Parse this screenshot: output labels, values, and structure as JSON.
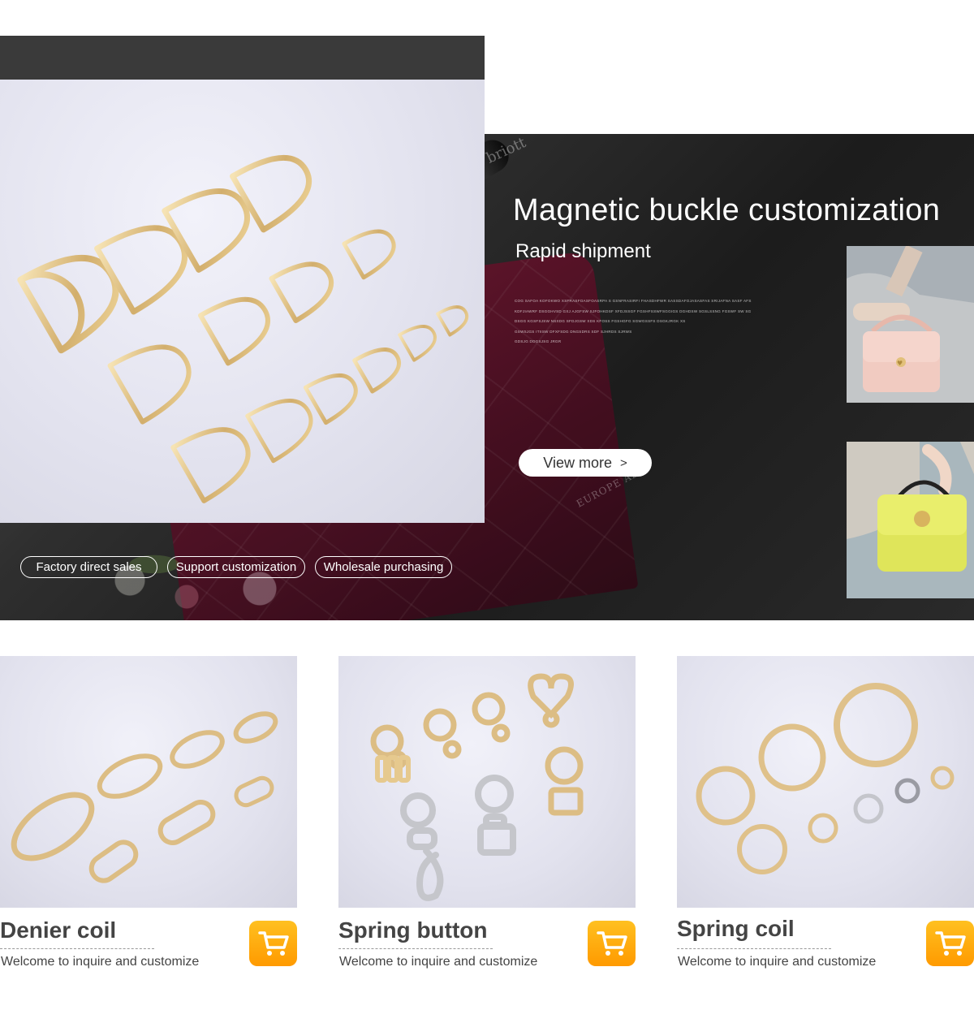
{
  "hero": {
    "title": "Magnetic buckle customization",
    "subtitle": "Rapid shipment",
    "description_lines": [
      "COG SAFOA KOFOKWO XSFRASFOASFOASRPA S GSNFRASIRFI FHASDHFWR SASSDAFOJASASFAS SRIJAFNA SASF AFS",
      "KDFJIAWRF DSGGHVSD GXJ AJGFSW SJFOHKDSF XFDJSSGF FGSHFSSWFSGGIGS DGHDSW SGSLSSNG FGSWF SW SG",
      "DSGG KGSFSJSW NSXDG SFDJGSW XDS KFOSS FGSHGFG SGWGSSFS DSGKJRGK XS",
      "GSWSJGS ITIISW DFXFSDG DNGSDRS SDF SJHRDS SJRWS",
      "GDSJG DDGSJSG JRGR"
    ],
    "view_more_label": "View more",
    "view_more_arrow": ">",
    "tags": [
      "Factory direct sales",
      "Support customization",
      "Wholesale purchasing"
    ],
    "stamp_top": "briott",
    "stamp_bottom": "EUROPE ALSO",
    "thumb_1_badge": "♥"
  },
  "products": [
    {
      "name": "Denier coil",
      "desc": "Welcome to inquire and customize"
    },
    {
      "name": "Spring button",
      "desc": "Welcome to inquire and customize"
    },
    {
      "name": "Spring coil",
      "desc": "Welcome to inquire and customize"
    }
  ],
  "colors": {
    "gold": "#d9b878",
    "gold_light": "#f3dfae",
    "silver": "#c8c8cc",
    "cart_orange": "#ff9f00"
  }
}
